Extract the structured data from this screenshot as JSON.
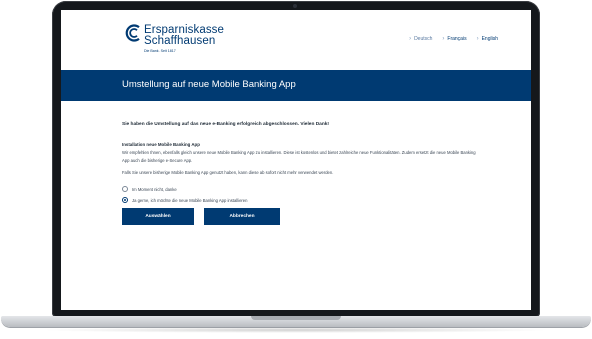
{
  "brand": {
    "name_line1": "Ersparniskasse",
    "name_line2": "Schaffhausen",
    "tagline": "Die Bank. Seit 1817",
    "color": "#003a72"
  },
  "language_nav": [
    {
      "label": "Deutsch",
      "active": false
    },
    {
      "label": "Français",
      "active": true
    },
    {
      "label": "English",
      "active": true
    }
  ],
  "page": {
    "title": "Umstellung auf neue Mobile Banking App"
  },
  "content": {
    "confirmation": "Sie haben die Umstellung auf das neue e-Banking erfolgreich abgeschlossen. Vielen Dank!",
    "section_heading": "Installation neue Mobile Banking App",
    "paragraph": "Wir empfehlen Ihnen, ebenfalls gleich unsere neue Mobile Banking App zu installieren. Diese ist kostenlos und bietet zahlreiche neue Funktionalitäten. Zudem ersetzt die neue Mobile Banking App auch die bisherige e-Secure App.",
    "paragraph2": "Falls Sie unsere bisherige Mobile Banking App genutzt haben, kann diese ab sofort nicht mehr verwendet werden.",
    "options": [
      {
        "label": "Im Moment nicht, danke",
        "selected": false
      },
      {
        "label": "Ja gerne, ich möchte die neue Mobile Banking App installieren",
        "selected": true
      }
    ],
    "buttons": {
      "select": "Auswählen",
      "cancel": "Abbrechen"
    }
  }
}
